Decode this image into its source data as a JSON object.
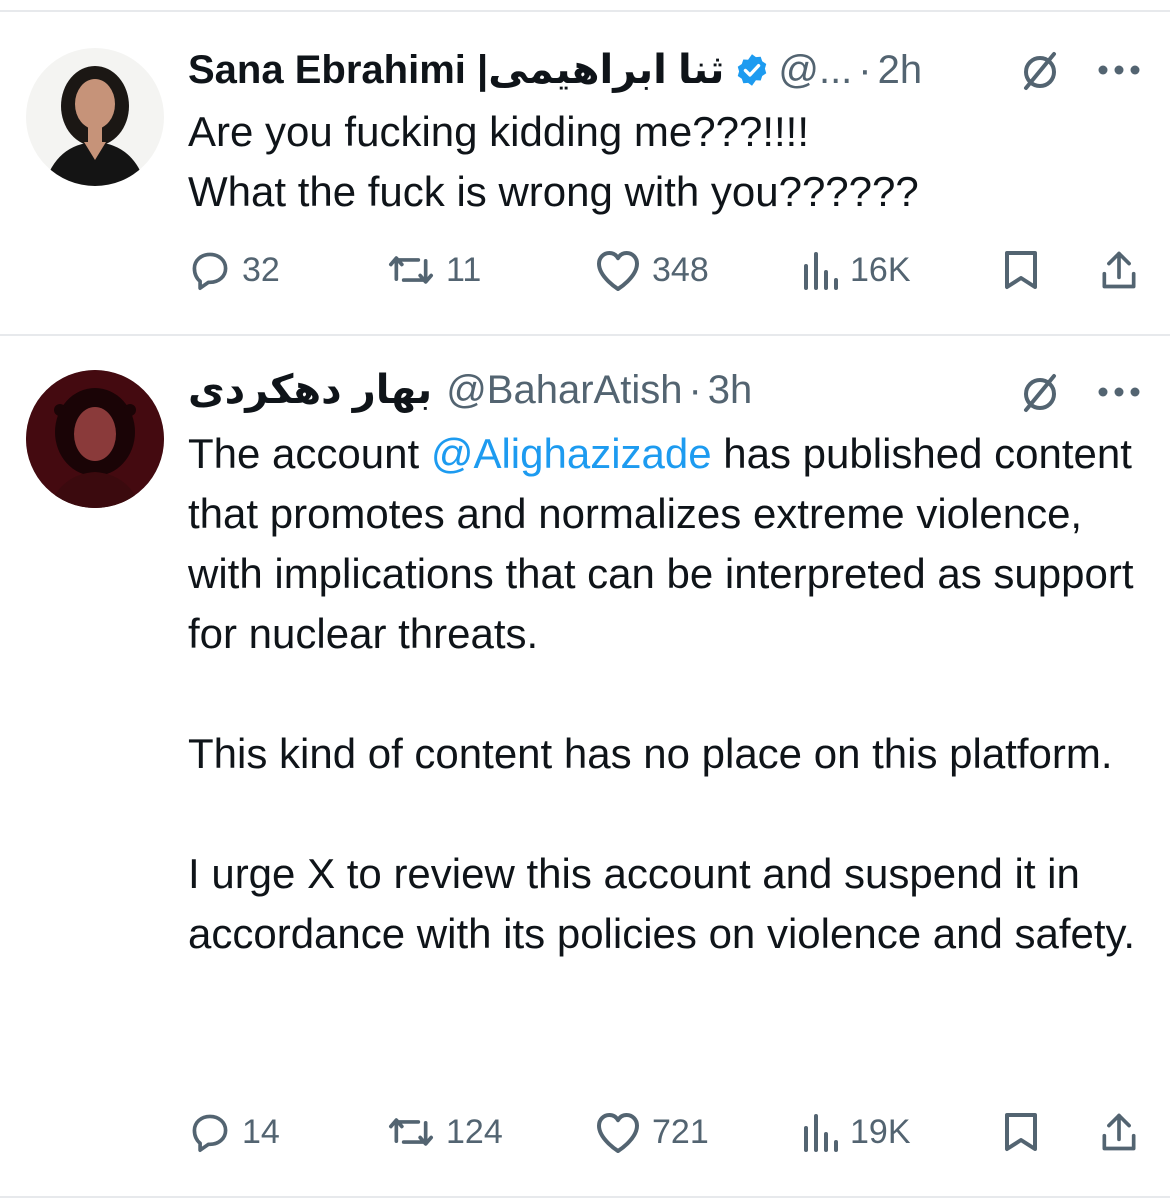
{
  "tweets": [
    {
      "display_name": "Sana Ebrahimi | ",
      "display_name_rtl": "ثنا ابراهیمی",
      "verified": true,
      "handle": "@...",
      "separator": "·",
      "time": "2h",
      "body_lines": [
        "Are you fucking kidding me???!!!!",
        "What the fuck is wrong with you??????"
      ],
      "stats": {
        "replies": "32",
        "reposts": "11",
        "likes": "348",
        "views": "16K"
      }
    },
    {
      "display_name_rtl": "بهار دهکردی",
      "handle": "@BaharAtish",
      "separator": "·",
      "time": "3h",
      "body": {
        "p1_before": "The account ",
        "p1_mention": "@Alighazizade",
        "p1_after": " has published content that promotes and normalizes extreme violence, with implications that can be interpreted as support for nuclear threats.",
        "p2": "This kind of content has no place on this platform.",
        "p3": "I urge X to review this account and suspend it in accordance with its policies on violence and safety."
      },
      "stats": {
        "replies": "14",
        "reposts": "124",
        "likes": "721",
        "views": "19K"
      }
    }
  ],
  "icons": {
    "verified": "verified-badge-icon",
    "grok": "grok-icon",
    "more": "more-icon",
    "reply": "reply-icon",
    "repost": "repost-icon",
    "like": "like-icon",
    "views": "views-icon",
    "bookmark": "bookmark-icon",
    "share": "share-icon"
  },
  "colors": {
    "accent": "#1d9bf0",
    "text": "#0f1419",
    "secondary": "#536471",
    "divider": "#e7e9ec"
  }
}
